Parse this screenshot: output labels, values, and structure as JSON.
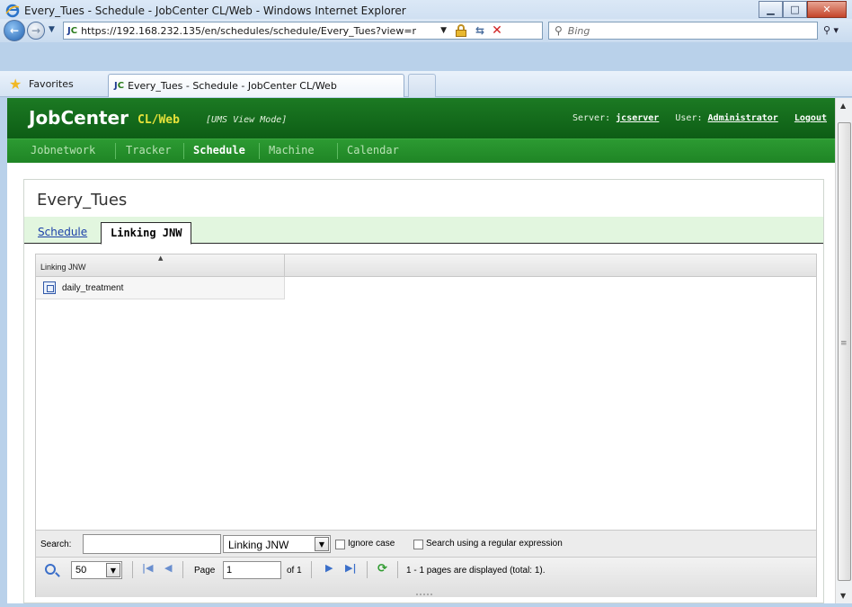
{
  "window": {
    "title": "Every_Tues - Schedule - JobCenter CL/Web - Windows Internet Explorer",
    "minimize_label": "▭",
    "maximize_label": "□",
    "close_label": "x"
  },
  "browser": {
    "address": "https://192.168.232.135/en/schedules/schedule/Every_Tues?view=r",
    "search_placeholder": "Bing",
    "favorites_label": "Favorites",
    "tab_title": "Every_Tues - Schedule - JobCenter CL/Web",
    "site_icon_text": "JC"
  },
  "app": {
    "brand": "JobCenter",
    "brand_sub": "CL/Web",
    "mode": "[UMS View Mode]",
    "server_label": "Server:",
    "server_value": "jcserver",
    "user_label": "User:",
    "user_value": "Administrator",
    "logout_label": "Logout"
  },
  "nav": {
    "items": [
      {
        "label": "Jobnetwork"
      },
      {
        "label": "Tracker"
      },
      {
        "label": "Schedule"
      },
      {
        "label": "Machine"
      },
      {
        "label": "Calendar"
      }
    ],
    "active": "Schedule"
  },
  "page": {
    "title": "Every_Tues",
    "tabs": [
      {
        "label": "Schedule"
      },
      {
        "label": "Linking JNW"
      }
    ],
    "active_tab": "Linking JNW"
  },
  "grid": {
    "column_header": "Linking JNW",
    "rows": [
      {
        "name": "daily_treatment"
      }
    ]
  },
  "search": {
    "label": "Search:",
    "value": "",
    "field_select": "Linking JNW",
    "ignore_case_label": "Ignore case",
    "regex_label": "Search using a regular expression"
  },
  "pager": {
    "page_size": "50",
    "page_label": "Page",
    "page_value": "1",
    "of_label": "of 1",
    "status": "1 - 1 pages are displayed (total: 1)."
  },
  "colors": {
    "header_green": "#1c7a23",
    "nav_green": "#2c9a32",
    "brand_yellow": "#e6e23a",
    "tab_strip": "#e2f6df"
  }
}
